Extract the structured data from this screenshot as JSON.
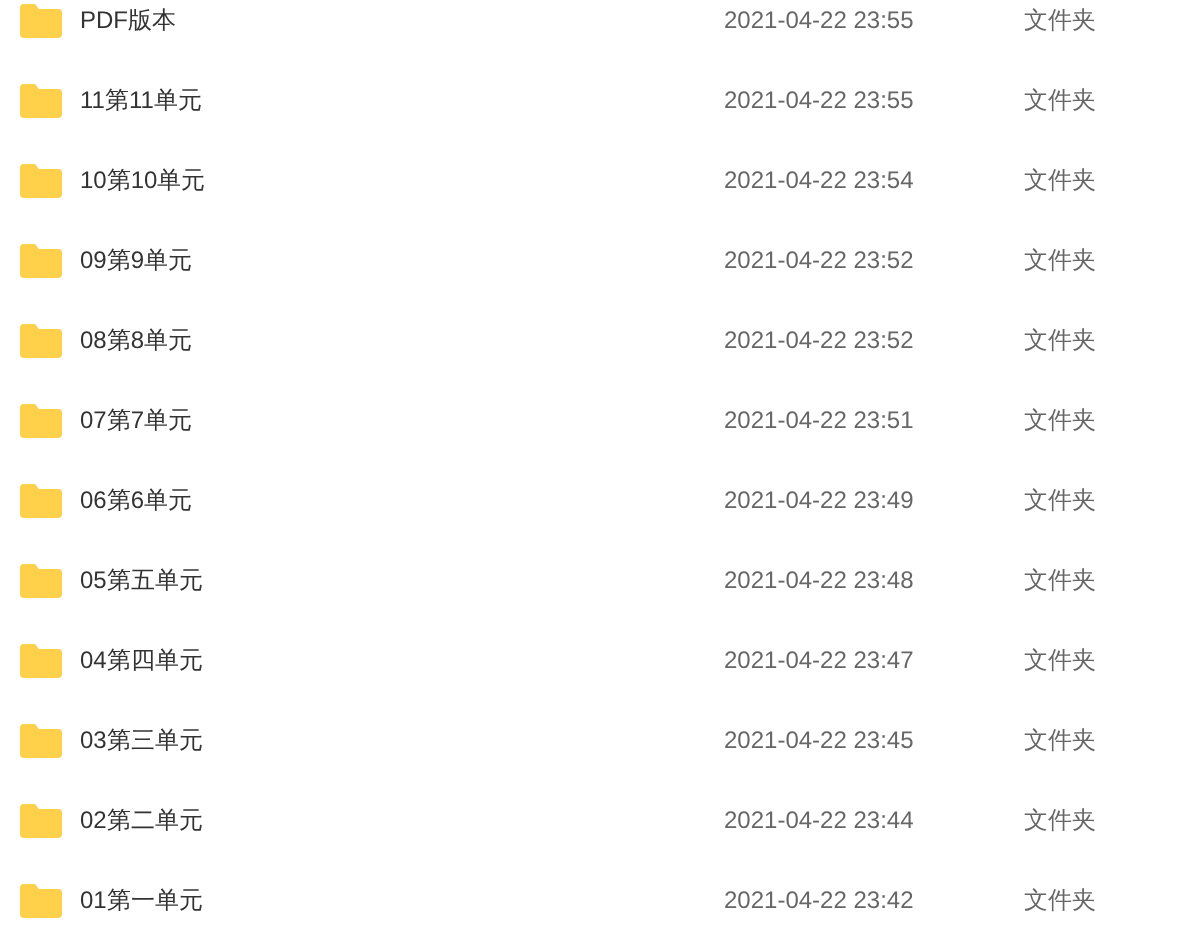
{
  "files": [
    {
      "name": "PDF版本",
      "modified": "2021-04-22 23:55",
      "type": "文件夹"
    },
    {
      "name": "11第11单元",
      "modified": "2021-04-22 23:55",
      "type": "文件夹"
    },
    {
      "name": "10第10单元",
      "modified": "2021-04-22 23:54",
      "type": "文件夹"
    },
    {
      "name": "09第9单元",
      "modified": "2021-04-22 23:52",
      "type": "文件夹"
    },
    {
      "name": "08第8单元",
      "modified": "2021-04-22 23:52",
      "type": "文件夹"
    },
    {
      "name": "07第7单元",
      "modified": "2021-04-22 23:51",
      "type": "文件夹"
    },
    {
      "name": "06第6单元",
      "modified": "2021-04-22 23:49",
      "type": "文件夹"
    },
    {
      "name": "05第五单元",
      "modified": "2021-04-22 23:48",
      "type": "文件夹"
    },
    {
      "name": "04第四单元",
      "modified": "2021-04-22 23:47",
      "type": "文件夹"
    },
    {
      "name": "03第三单元",
      "modified": "2021-04-22 23:45",
      "type": "文件夹"
    },
    {
      "name": "02第二单元",
      "modified": "2021-04-22 23:44",
      "type": "文件夹"
    },
    {
      "name": "01第一单元",
      "modified": "2021-04-22 23:42",
      "type": "文件夹"
    }
  ]
}
